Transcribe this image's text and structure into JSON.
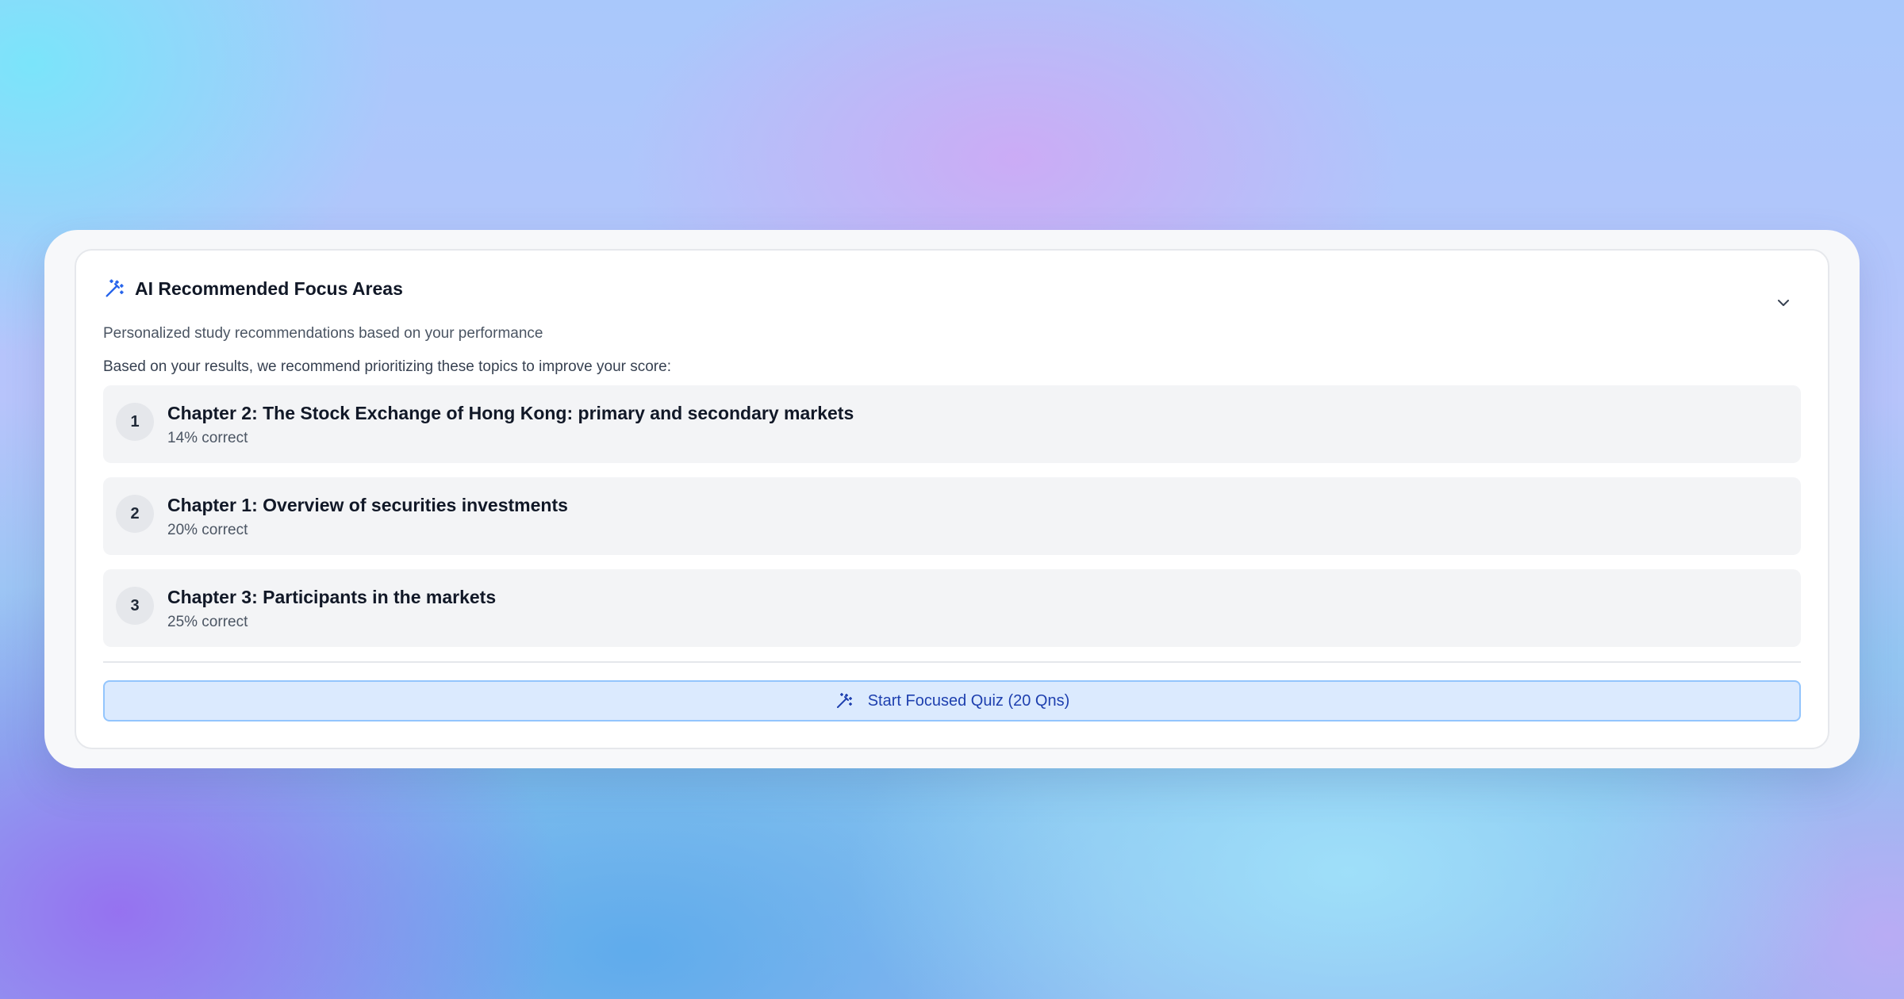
{
  "card": {
    "title": "AI Recommended Focus Areas",
    "subtitle": "Personalized study recommendations based on your performance",
    "intro": "Based on your results, we recommend prioritizing these topics to improve your score:",
    "title_icon": "magic-wand-icon",
    "collapse_icon": "chevron-down-icon"
  },
  "recommendations": [
    {
      "rank": "1",
      "title": "Chapter 2: The Stock Exchange of Hong Kong: primary and secondary markets",
      "score": "14% correct"
    },
    {
      "rank": "2",
      "title": "Chapter 1: Overview of securities investments",
      "score": "20% correct"
    },
    {
      "rank": "3",
      "title": "Chapter 3: Participants in the markets",
      "score": "25% correct"
    }
  ],
  "action": {
    "label": "Start Focused Quiz (20 Qns)",
    "icon": "magic-wand-icon"
  },
  "colors": {
    "accent": "#2563eb",
    "button_bg": "#dbeafe",
    "button_border": "#93c5fd",
    "button_text": "#1e40af"
  }
}
